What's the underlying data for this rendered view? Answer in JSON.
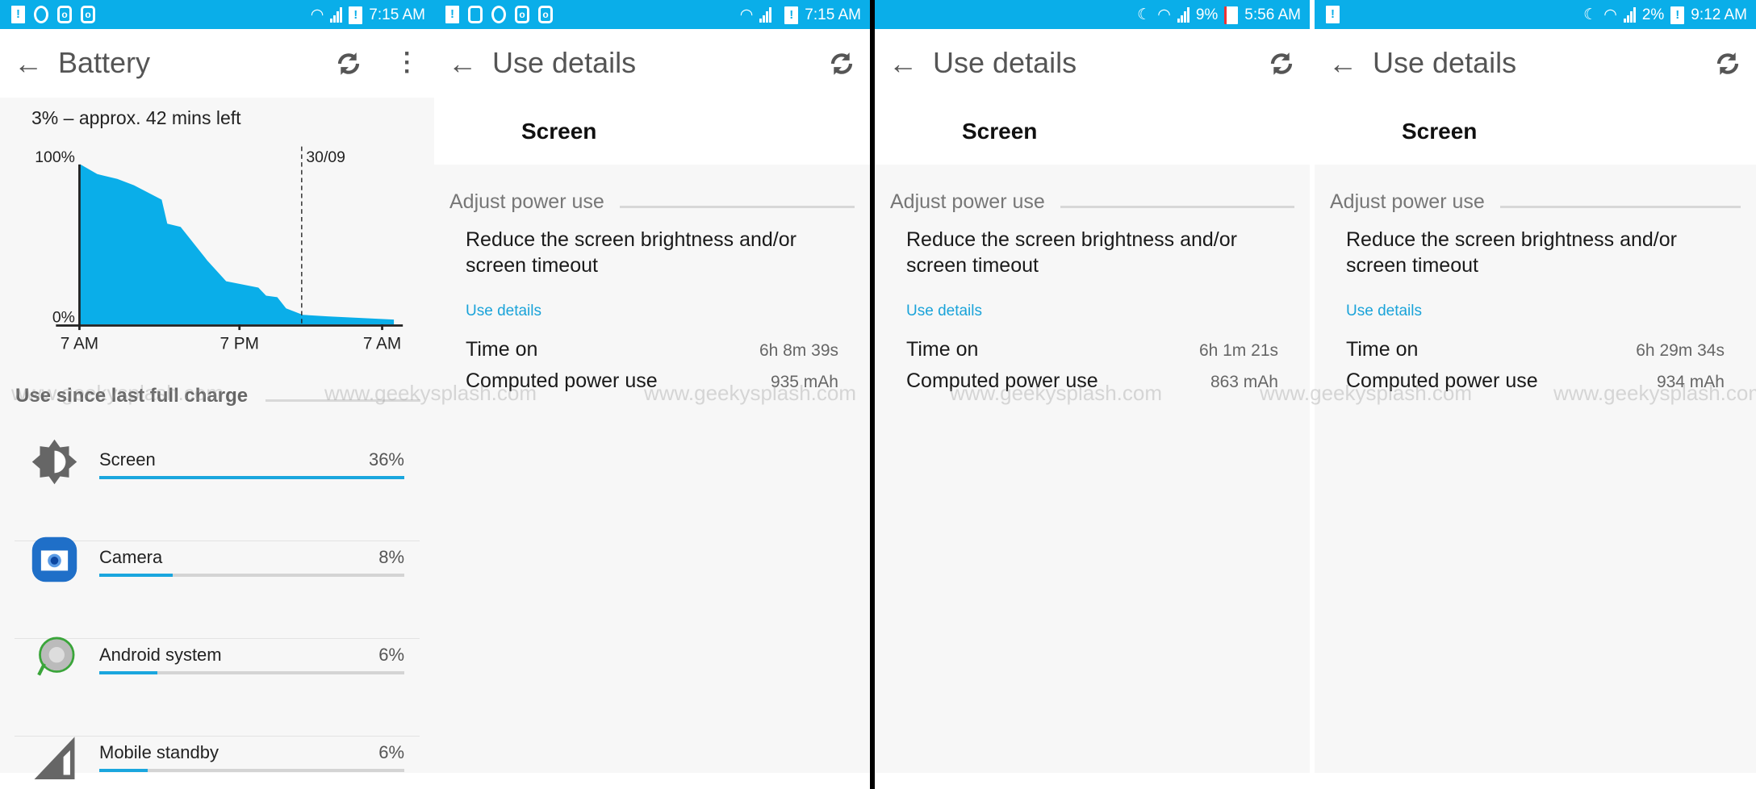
{
  "colors": {
    "status_bar": "#0aaee9",
    "accent": "#1aa6de",
    "link": "#1aa3d9",
    "chart_fill": "#0aaee9"
  },
  "watermark": "www.geekysplash.com",
  "battery_panel": {
    "status": {
      "left_icons": [
        "battery-alert-icon",
        "whatsapp-icon",
        "instagram-icon",
        "instagram-icon"
      ],
      "time": "7:15 AM"
    },
    "title": "Battery",
    "remaining": "3% – approx. 42 mins left",
    "chart_data": {
      "type": "area",
      "y_ticks": [
        "100%",
        "0%"
      ],
      "ylim": [
        0,
        100
      ],
      "x_ticks": [
        "7 AM",
        "7 PM",
        "7 AM"
      ],
      "date_marker": "30/09",
      "points": [
        [
          "07:05",
          100
        ],
        [
          "08:20",
          94
        ],
        [
          "09:50",
          91
        ],
        [
          "11:05",
          87
        ],
        [
          "13:10",
          78
        ],
        [
          "13:35",
          63
        ],
        [
          "14:35",
          61
        ],
        [
          "16:35",
          40
        ],
        [
          "18:00",
          27
        ],
        [
          "20:25",
          23
        ],
        [
          "21:00",
          18
        ],
        [
          "21:50",
          17
        ],
        [
          "22:30",
          10
        ],
        [
          "23:45",
          6
        ],
        [
          "01:35",
          5
        ],
        [
          "06:35",
          3
        ]
      ]
    },
    "section": "Use since last full charge",
    "items": [
      {
        "label": "Screen",
        "percent": "36%",
        "bar": 100,
        "icon": "brightness-icon"
      },
      {
        "label": "Camera",
        "percent": "8%",
        "bar": 24,
        "icon": "camera-icon"
      },
      {
        "label": "Android system",
        "percent": "6%",
        "bar": 19,
        "icon": "android-system-icon"
      },
      {
        "label": "Mobile standby",
        "percent": "6%",
        "bar": 16,
        "icon": "cell-signal-icon"
      }
    ]
  },
  "details": [
    {
      "status": {
        "battery": "",
        "time": "7:15 AM"
      },
      "title": "Use details",
      "app": "Screen",
      "section": "Adjust power use",
      "tip": "Reduce the screen brightness and/or",
      "tip2": "screen timeout",
      "link": "Use details",
      "time_on_label": "Time on",
      "time_on": "6h 8m 39s",
      "power_label": "Computed power use",
      "power": "935 mAh"
    },
    {
      "status": {
        "battery": "9%",
        "time": "5:56 AM"
      },
      "title": "Use details",
      "app": "Screen",
      "section": "Adjust power use",
      "tip": "Reduce the screen brightness and/or",
      "tip2": "screen timeout",
      "link": "Use details",
      "time_on_label": "Time on",
      "time_on": "6h 1m 21s",
      "power_label": "Computed power use",
      "power": "863 mAh"
    },
    {
      "status": {
        "battery": "2%",
        "time": "9:12 AM"
      },
      "title": "Use details",
      "app": "Screen",
      "section": "Adjust power use",
      "tip": "Reduce the screen brightness and/or",
      "tip2": "screen timeout",
      "link": "Use details",
      "time_on_label": "Time on",
      "time_on": "6h 29m 34s",
      "power_label": "Computed power use",
      "power": "934 mAh"
    }
  ]
}
